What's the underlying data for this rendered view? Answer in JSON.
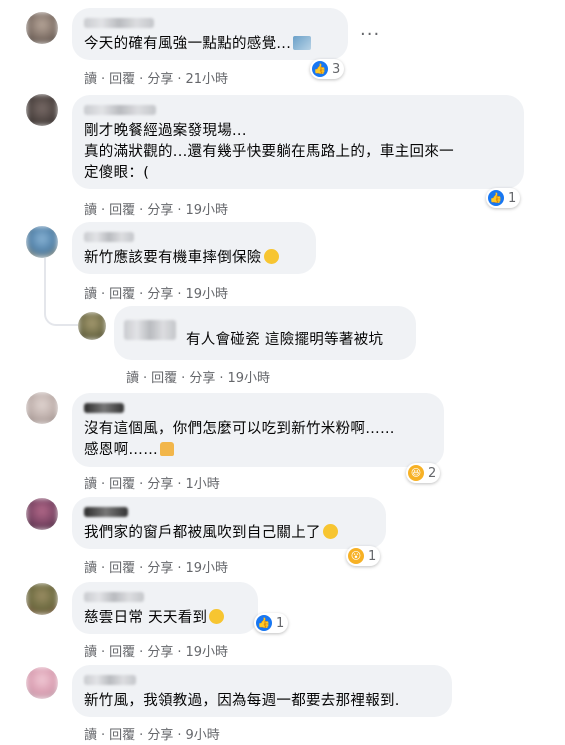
{
  "actions": {
    "read": "讀",
    "reply": "回覆",
    "share": "分享",
    "sep": "·"
  },
  "comments": [
    {
      "text": "今天的確有風強一點點的感覺...",
      "time": "21小時",
      "react_count": "3",
      "react_type": "like-icon"
    },
    {
      "text": "剛才晚餐經過案發現場...\n真的滿狀觀的...還有幾乎快要躺在馬路上的，車主回來一\n定傻眼：(",
      "time": "19小時",
      "react_count": "1",
      "react_type": "like-icon"
    },
    {
      "text": "新竹應該要有機車摔倒保險",
      "time": "19小時"
    },
    {
      "text": "有人會碰瓷 這險擺明等著被坑",
      "time": "19小時"
    },
    {
      "text": "沒有這個風，你們怎麼可以吃到新竹米粉啊……\n感恩啊……",
      "time": "1小時",
      "react_count": "2",
      "react_type": "haha-icon"
    },
    {
      "text": "我們家的窗戶都被風吹到自己關上了",
      "time": "19小時",
      "react_count": "1",
      "react_type": "wow-icon"
    },
    {
      "text": "慈雲日常 天天看到",
      "time": "19小時",
      "react_count": "1",
      "react_type": "like-icon"
    },
    {
      "text": "新竹風，我領教過，因為每週一都要去那裡報到.",
      "time": "9小時"
    }
  ],
  "more_label": "···",
  "colors": {
    "bubble": "#f0f2f5",
    "meta": "#65676b",
    "like": "#1877f2",
    "haha": "#f7b125"
  }
}
